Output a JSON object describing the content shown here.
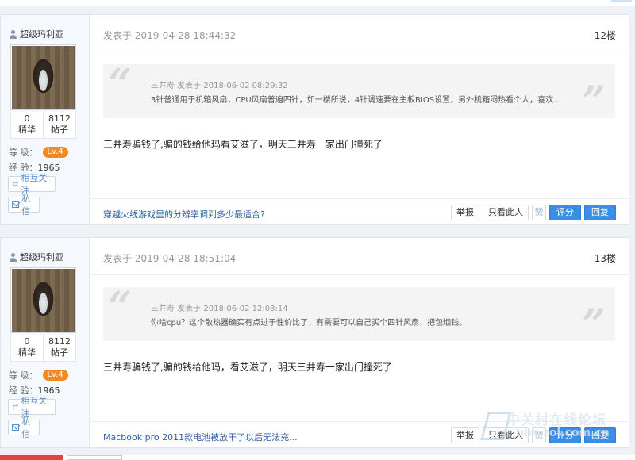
{
  "posts": [
    {
      "author": "超级玛利亚",
      "stats": [
        {
          "num": "0",
          "label": "精华"
        },
        {
          "num": "8112",
          "label": "帖子"
        }
      ],
      "level_label": "等 级：",
      "level": "Lv.4",
      "exp_label": "经 验：",
      "exp": "1965",
      "follow_label": "相互关注",
      "message_label": "私信",
      "posted_at": "发表于 2019-04-28 18:44:32",
      "floor": "12楼",
      "quote_header": "三井寿 发表于 2018-06-02 08:29:32",
      "quote_text": "3针普通用于机箱风扇，CPU风扇普遍四针，如一楼所说，4针调速要在主板BIOS设置，另外机箱闷热看个人，喜欢...",
      "content": "三井寿骗钱了,骗的钱给他玛看艾滋了，明天三井寿一家出门撞死了",
      "footer_link": "穿越火线游戏里的分辨率调到多少最适合?",
      "actions": {
        "report": "举报",
        "only_author": "只看此人",
        "like": "赞",
        "rate": "评分",
        "reply": "回复"
      }
    },
    {
      "author": "超级玛利亚",
      "stats": [
        {
          "num": "0",
          "label": "精华"
        },
        {
          "num": "8112",
          "label": "帖子"
        }
      ],
      "level_label": "等 级：",
      "level": "Lv.4",
      "exp_label": "经 验：",
      "exp": "1965",
      "follow_label": "相互关注",
      "message_label": "私信",
      "posted_at": "发表于 2019-04-28 18:51:04",
      "floor": "13楼",
      "quote_header": "三井寿 发表于 2018-06-02 12:03:14",
      "quote_text": "你啥cpu？这个散热器确实有点过于性价比了，有需要可以自己买个四针风扇，把包烟钱。",
      "content": "三井寿骗钱了,骗的钱给他玛，看艾滋了，明天三井寿一家出门撞死了",
      "footer_link": "Macbook pro 2011款电池被放干了以后无法充...",
      "actions": {
        "report": "举报",
        "only_author": "只看此人",
        "like": "赞",
        "rate": "评分",
        "reply": "回复"
      }
    }
  ],
  "watermark": {
    "cn": "中关村在线论坛",
    "en": "bbs.zol.com.cn"
  },
  "colors": {
    "accent": "#3a8ee6",
    "level_badge": "#f08a24",
    "link": "#2f5fa3"
  }
}
